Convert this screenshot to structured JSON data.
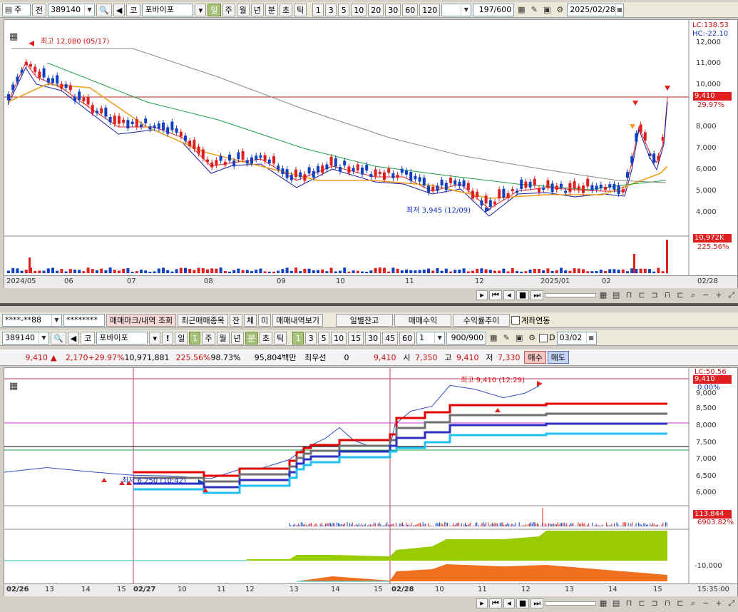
{
  "top_toolbar": {
    "market": "주",
    "code_label": "전",
    "code": "389140",
    "exchange_badge": "코",
    "name": "포바이포",
    "periods": [
      "일",
      "주",
      "월",
      "년",
      "분",
      "초",
      "틱"
    ],
    "active_period": "일",
    "numbers": [
      "1",
      "3",
      "5",
      "10",
      "20",
      "30",
      "60",
      "120"
    ],
    "count": "197",
    "count_total": "/600",
    "date": "2025/02/28"
  },
  "daily_chart": {
    "lc": "LC:138.53",
    "hc": "HC:-22.10",
    "price_axis": [
      "12,000",
      "11,000",
      "10,000",
      "9,410",
      "29.97%",
      "8,000",
      "7,000",
      "6,000",
      "5,000",
      "4,000"
    ],
    "current_price_tag": "9,410",
    "current_pct": "29.97%",
    "high_note": "최고 12,080 (05/17)",
    "low_note": "최저 3,945 (12/09)",
    "volume_tag": "10,972K",
    "volume_pct": "225.56%",
    "date_labels": [
      "2024/05",
      "06",
      "07",
      "08",
      "09",
      "10",
      "11",
      "12",
      "2025/01",
      "02",
      "02/28"
    ]
  },
  "panel2_tabs": {
    "account_masked": "****-**88",
    "password_masked": "********",
    "tab1": "매매마크/내역",
    "tab1_b": "조회",
    "tab2": "최근매매종목",
    "mini": [
      "잔",
      "체",
      "미"
    ],
    "tab3": "매매내역보기",
    "right_tabs": [
      "일별잔고",
      "매매수익",
      "수익률추이"
    ],
    "link_label": "계좌연동"
  },
  "panel2_toolbar": {
    "code": "389140",
    "exchange_badge": "코",
    "name": "포바이포",
    "warn": "!",
    "period_day": "일",
    "period_num": "1",
    "periods": [
      "주",
      "월",
      "년",
      "분",
      "초",
      "틱"
    ],
    "active_period": "분",
    "nums": [
      "1",
      "3",
      "5",
      "10",
      "15",
      "30",
      "45",
      "60"
    ],
    "active_num": "1",
    "count_sel": "1",
    "count": "900",
    "count_total": "/900",
    "date": "03/02"
  },
  "info_bar": {
    "price": "9,410",
    "change": "2,170",
    "rate": "+29.97%",
    "volume": "10,971,881",
    "vol_rate": "225.56%",
    "other_rate": "98.73%",
    "amount": "95,804백만",
    "quote_label": "최우선",
    "quote_value": "0",
    "price2": "9,410",
    "open_label": "시",
    "open": "7,350",
    "high_label": "고",
    "high": "9,410",
    "low_label": "저",
    "low": "7,330",
    "buy": "매수",
    "sell": "매도"
  },
  "minute_chart": {
    "lc": "LC:50.56",
    "price_axis": [
      "9,000",
      "8,500",
      "8,000",
      "7,500",
      "7,000",
      "6,500",
      "6,000"
    ],
    "price_tag": "9,410",
    "pct": "0.00%",
    "high_note": "최고 9,410 (12:29)",
    "low_note": "최저 6,250 (10:42)",
    "volume_tag": "113,844",
    "volume_pct": "6903.82%",
    "indicator_axis": "-10,000",
    "time_labels": [
      "02/26",
      "13",
      "14",
      "15",
      "02/27",
      "10",
      "11",
      "12",
      "13",
      "14",
      "15",
      "02/28",
      "10",
      "11",
      "12",
      "13",
      "14",
      "15",
      "15:35:00"
    ]
  },
  "colors": {
    "candle_up": "#e02020",
    "candle_down": "#1040c0",
    "ma5": "#e02020",
    "ma10": "#1a1aa0",
    "ma20": "#f0a020",
    "ma60": "#20a040",
    "ma120": "#888888",
    "green_hist": "#99cc00",
    "orange_hist": "#f07020",
    "active_tab": "#a7c27a"
  }
}
